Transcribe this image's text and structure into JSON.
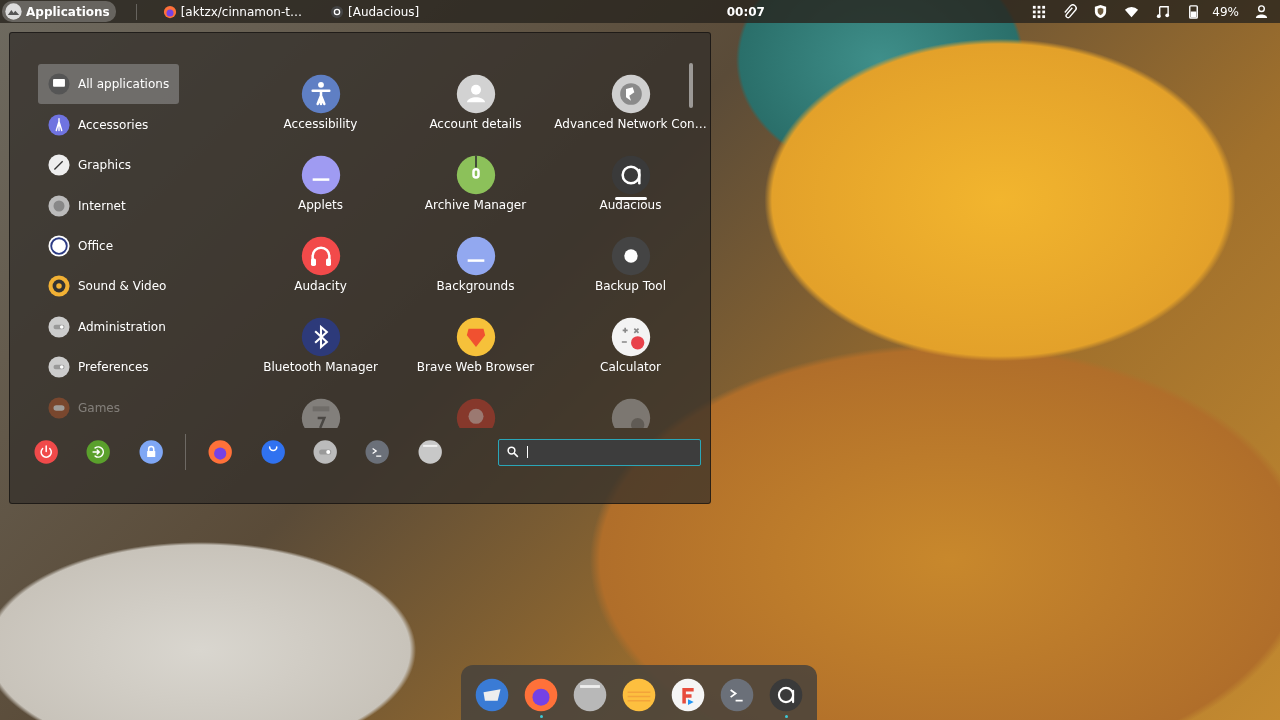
{
  "panel": {
    "menu_button": "Applications",
    "windows": [
      {
        "title": "[aktzx/cinnamon-t…",
        "kind": "browser"
      },
      {
        "title": "[Audacious]",
        "kind": "player"
      }
    ],
    "clock": "00:07",
    "battery": "49%"
  },
  "menu": {
    "categories": [
      {
        "label": "All applications",
        "selected": true,
        "disabled": false
      },
      {
        "label": "Accessories",
        "selected": false,
        "disabled": false
      },
      {
        "label": "Graphics",
        "selected": false,
        "disabled": false
      },
      {
        "label": "Internet",
        "selected": false,
        "disabled": false
      },
      {
        "label": "Office",
        "selected": false,
        "disabled": false
      },
      {
        "label": "Sound & Video",
        "selected": false,
        "disabled": false
      },
      {
        "label": "Administration",
        "selected": false,
        "disabled": false
      },
      {
        "label": "Preferences",
        "selected": false,
        "disabled": false
      },
      {
        "label": "Games",
        "selected": false,
        "disabled": true
      }
    ],
    "apps": [
      {
        "label": "Accessibility",
        "running": false
      },
      {
        "label": "Account details",
        "running": false
      },
      {
        "label": "Advanced Network Con…",
        "running": false
      },
      {
        "label": "Applets",
        "running": false
      },
      {
        "label": "Archive Manager",
        "running": false
      },
      {
        "label": "Audacious",
        "running": true
      },
      {
        "label": "Audacity",
        "running": false
      },
      {
        "label": "Backgrounds",
        "running": false
      },
      {
        "label": "Backup Tool",
        "running": false
      },
      {
        "label": "Bluetooth Manager",
        "running": false
      },
      {
        "label": "Brave Web Browser",
        "running": false
      },
      {
        "label": "Calculator",
        "running": false
      }
    ]
  },
  "dock": [
    {
      "running": false
    },
    {
      "running": true
    },
    {
      "running": false
    },
    {
      "running": false
    },
    {
      "running": false
    },
    {
      "running": false
    },
    {
      "running": true
    }
  ]
}
